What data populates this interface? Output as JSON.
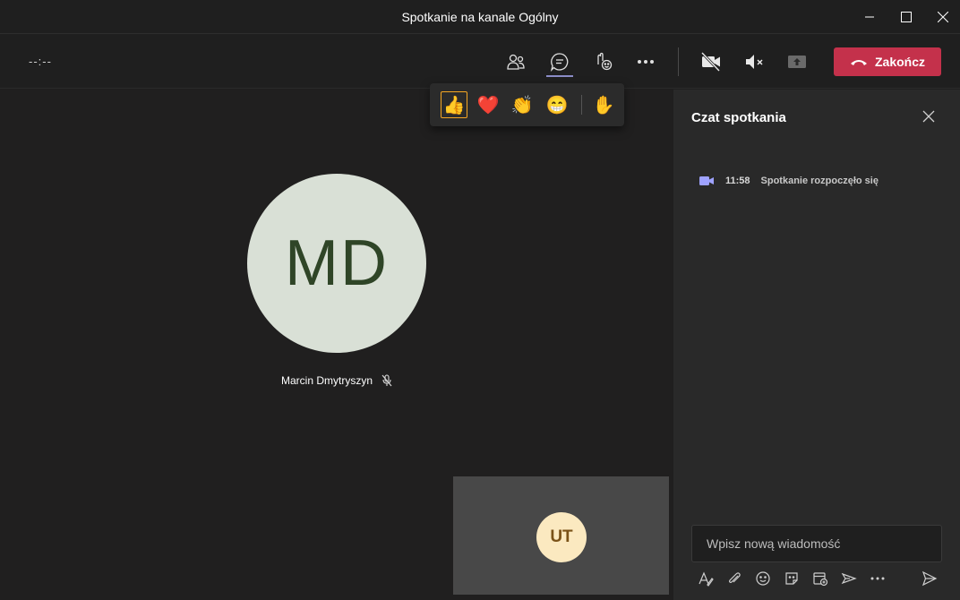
{
  "window": {
    "title": "Spotkanie na kanale Ogólny",
    "controls": [
      "minimize-icon",
      "maximize-icon",
      "close-icon"
    ]
  },
  "toolbar": {
    "timer": "--:--",
    "icons": [
      "participants-icon",
      "chat-icon",
      "reactions-icon",
      "more-icon",
      "camera-off-icon",
      "speaker-mute-icon",
      "share-tray-icon"
    ],
    "end_label": "Zakończ",
    "end_color": "#c4314b",
    "accent": "#8b8cc7"
  },
  "reactions": {
    "items": [
      "👍",
      "❤️",
      "👏",
      "😁"
    ],
    "raise_hand": "✋",
    "selected_index": 0
  },
  "stage": {
    "participant": {
      "initials": "MD",
      "name": "Marcin Dmytryszyn",
      "muted": true,
      "avatar_color": "#d9e0d6"
    },
    "self": {
      "initials": "UT",
      "avatar_color": "#fbe9c0"
    }
  },
  "chat": {
    "title": "Czat spotkania",
    "events": [
      {
        "time": "11:58",
        "text": "Spotkanie rozpoczęło się",
        "icon": "video-icon"
      }
    ],
    "compose_placeholder": "Wpisz nową wiadomość",
    "format_icons": [
      "format-icon",
      "attach-icon",
      "emoji-icon",
      "sticker-icon",
      "schedule-meeting-icon",
      "praise-icon",
      "more-options-icon"
    ],
    "send_icon": "send-icon"
  }
}
